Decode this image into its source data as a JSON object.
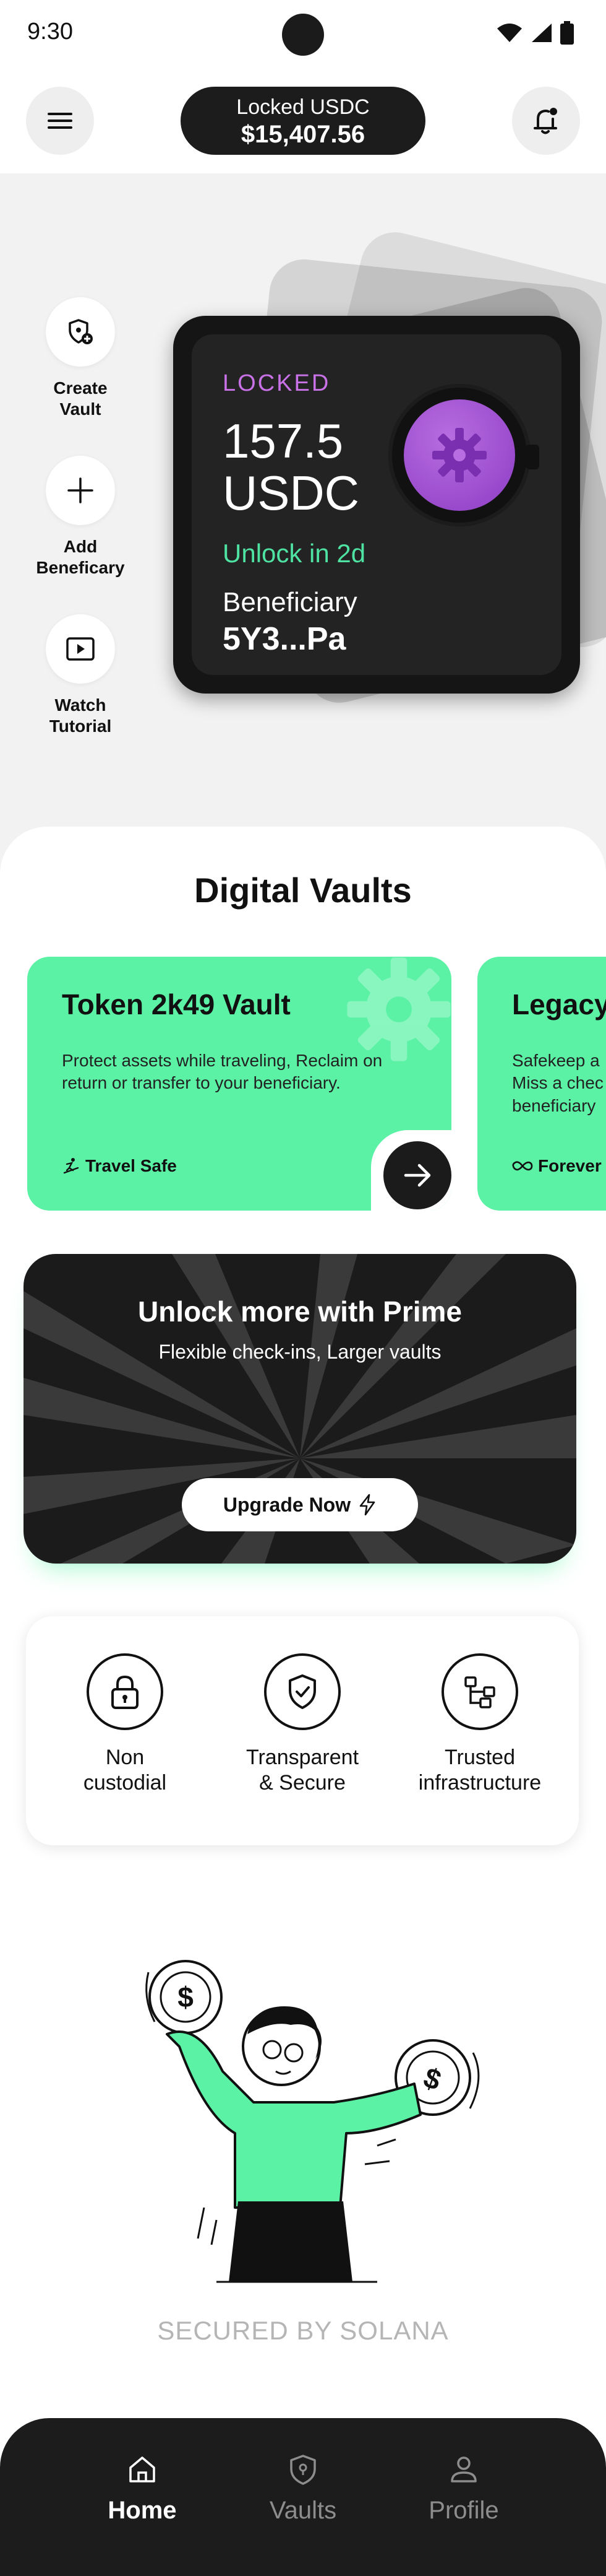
{
  "status_bar": {
    "time": "9:30"
  },
  "header": {
    "locked_label": "Locked USDC",
    "locked_amount": "$15,407.56"
  },
  "side_actions": [
    {
      "label": "Create\nVault",
      "icon": "shield-plus-icon"
    },
    {
      "label": "Add\nBeneficary",
      "icon": "plus-icon"
    },
    {
      "label": "Watch\nTutorial",
      "icon": "play-icon"
    }
  ],
  "vault_card": {
    "status": "LOCKED",
    "amount": "157.5\nUSDC",
    "unlock": "Unlock in 2d",
    "beneficiary_label": "Beneficiary",
    "beneficiary_address": "5Y3...Pa",
    "accent_color": "#c971e6",
    "unlock_color": "#4ee3a3"
  },
  "digital_vaults": {
    "title": "Digital Vaults",
    "cards": [
      {
        "title": "Token 2k49 Vault",
        "description": "Protect assets while traveling, Reclaim on return or transfer to your beneficiary.",
        "tag": "Travel Safe",
        "tag_icon": "skier-icon"
      },
      {
        "title": "Legacy",
        "description": "Safekeep a\nMiss a chec\nbeneficiary",
        "tag": "Forever",
        "tag_icon": "infinity-icon"
      }
    ],
    "card_color": "#5bf2a6"
  },
  "prime": {
    "title": "Unlock more with Prime",
    "subtitle": "Flexible check-ins, Larger vaults",
    "button": "Upgrade Now"
  },
  "features": [
    {
      "label": "Non\ncustodial",
      "icon": "lock-icon"
    },
    {
      "label": "Transparent\n& Secure",
      "icon": "shield-check-icon"
    },
    {
      "label": "Trusted\ninfrastructure",
      "icon": "network-icon"
    }
  ],
  "footer_text": "SECURED BY SOLANA",
  "bottom_nav": [
    {
      "label": "Home",
      "icon": "home-icon",
      "active": true
    },
    {
      "label": "Vaults",
      "icon": "vault-shield-icon",
      "active": false
    },
    {
      "label": "Profile",
      "icon": "person-icon",
      "active": false
    }
  ]
}
